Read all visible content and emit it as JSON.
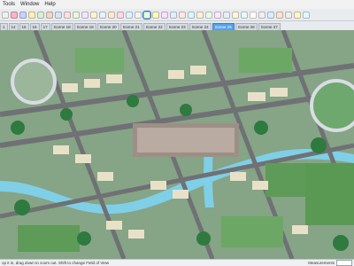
{
  "menu": [
    "Tools",
    "Window",
    "Help"
  ],
  "toolbar": {
    "tools": [
      {
        "name": "select-tool-icon",
        "color": "#f1f1f1"
      },
      {
        "name": "eraser-icon",
        "color": "#f7b6c8"
      },
      {
        "name": "line-tool-icon",
        "color": "#c8d3ff"
      },
      {
        "name": "arc-tool-icon",
        "color": "#fff0b3"
      },
      {
        "name": "rectangle-tool-icon",
        "color": "#d8f0d8"
      },
      {
        "name": "push-pull-icon",
        "color": "#f0d8c8"
      },
      {
        "name": "move-tool-icon",
        "color": "#d8e4f5"
      },
      {
        "name": "rotate-tool-icon",
        "color": "#ffe0e0"
      },
      {
        "name": "scale-tool-icon",
        "color": "#e8f7e0"
      },
      {
        "name": "offset-tool-icon",
        "color": "#f4e5ff"
      },
      {
        "name": "tape-measure-icon",
        "color": "#fff2d8"
      },
      {
        "name": "text-tool-icon",
        "color": "#e7f0ff"
      },
      {
        "name": "axes-tool-icon",
        "color": "#ffe9d1"
      },
      {
        "name": "paint-bucket-icon",
        "color": "#ffd9e6"
      },
      {
        "name": "orbit-icon",
        "color": "#dff3ff"
      },
      {
        "name": "pan-icon",
        "color": "#f4f4f4"
      },
      {
        "name": "zoom-icon",
        "color": "#e3ffe3"
      },
      {
        "name": "zoom-extents-icon",
        "color": "#fff7c2"
      },
      {
        "name": "walk-icon",
        "color": "#f8e0ff"
      },
      {
        "name": "look-around-icon",
        "color": "#e6ecff"
      },
      {
        "name": "section-plane-icon",
        "color": "#ffe6e6"
      },
      {
        "name": "iso-view-icon",
        "color": "#d9f7ff"
      },
      {
        "name": "top-view-icon",
        "color": "#fff0e0"
      },
      {
        "name": "front-view-icon",
        "color": "#eafbe6"
      },
      {
        "name": "right-view-icon",
        "color": "#fde7ff"
      },
      {
        "name": "back-view-icon",
        "color": "#e8eefc"
      },
      {
        "name": "left-view-icon",
        "color": "#fff6dd"
      },
      {
        "name": "xray-icon",
        "color": "#e7f9ff"
      },
      {
        "name": "wireframe-icon",
        "color": "#fff"
      },
      {
        "name": "hidden-line-icon",
        "color": "#f0f0f0"
      },
      {
        "name": "shaded-icon",
        "color": "#dcecff"
      },
      {
        "name": "textured-icon",
        "color": "#ffe2d2"
      },
      {
        "name": "monochrome-icon",
        "color": "#eeeeee"
      },
      {
        "name": "warehouse-icon",
        "color": "#fff5cc"
      },
      {
        "name": "extension-icon",
        "color": "#e5f7ff"
      }
    ]
  },
  "tabs": [
    {
      "label": "1",
      "active": false
    },
    {
      "label": "14",
      "active": false
    },
    {
      "label": "15",
      "active": false
    },
    {
      "label": "16",
      "active": false
    },
    {
      "label": "17",
      "active": false
    },
    {
      "label": "Scene 18",
      "active": false
    },
    {
      "label": "Scene 19",
      "active": false
    },
    {
      "label": "Scene 20",
      "active": false
    },
    {
      "label": "Scene 21",
      "active": false
    },
    {
      "label": "Scene 22",
      "active": false
    },
    {
      "label": "Scene 23",
      "active": false
    },
    {
      "label": "Scene 24",
      "active": false
    },
    {
      "label": "Scene 25",
      "active": true
    },
    {
      "label": "Scene 26",
      "active": false
    },
    {
      "label": "Scene 27",
      "active": false
    }
  ],
  "status": {
    "hint": "op it in, drag down to zoom out. Shift to change Field of View",
    "measurements_label": "Measurements"
  },
  "viewport": {
    "ground_color": "#8aa58a",
    "road_color": "#6f7175",
    "water_color": "#7fcfe6",
    "tree_color": "#2e7a3f",
    "building_color": "#e8e1c8"
  }
}
